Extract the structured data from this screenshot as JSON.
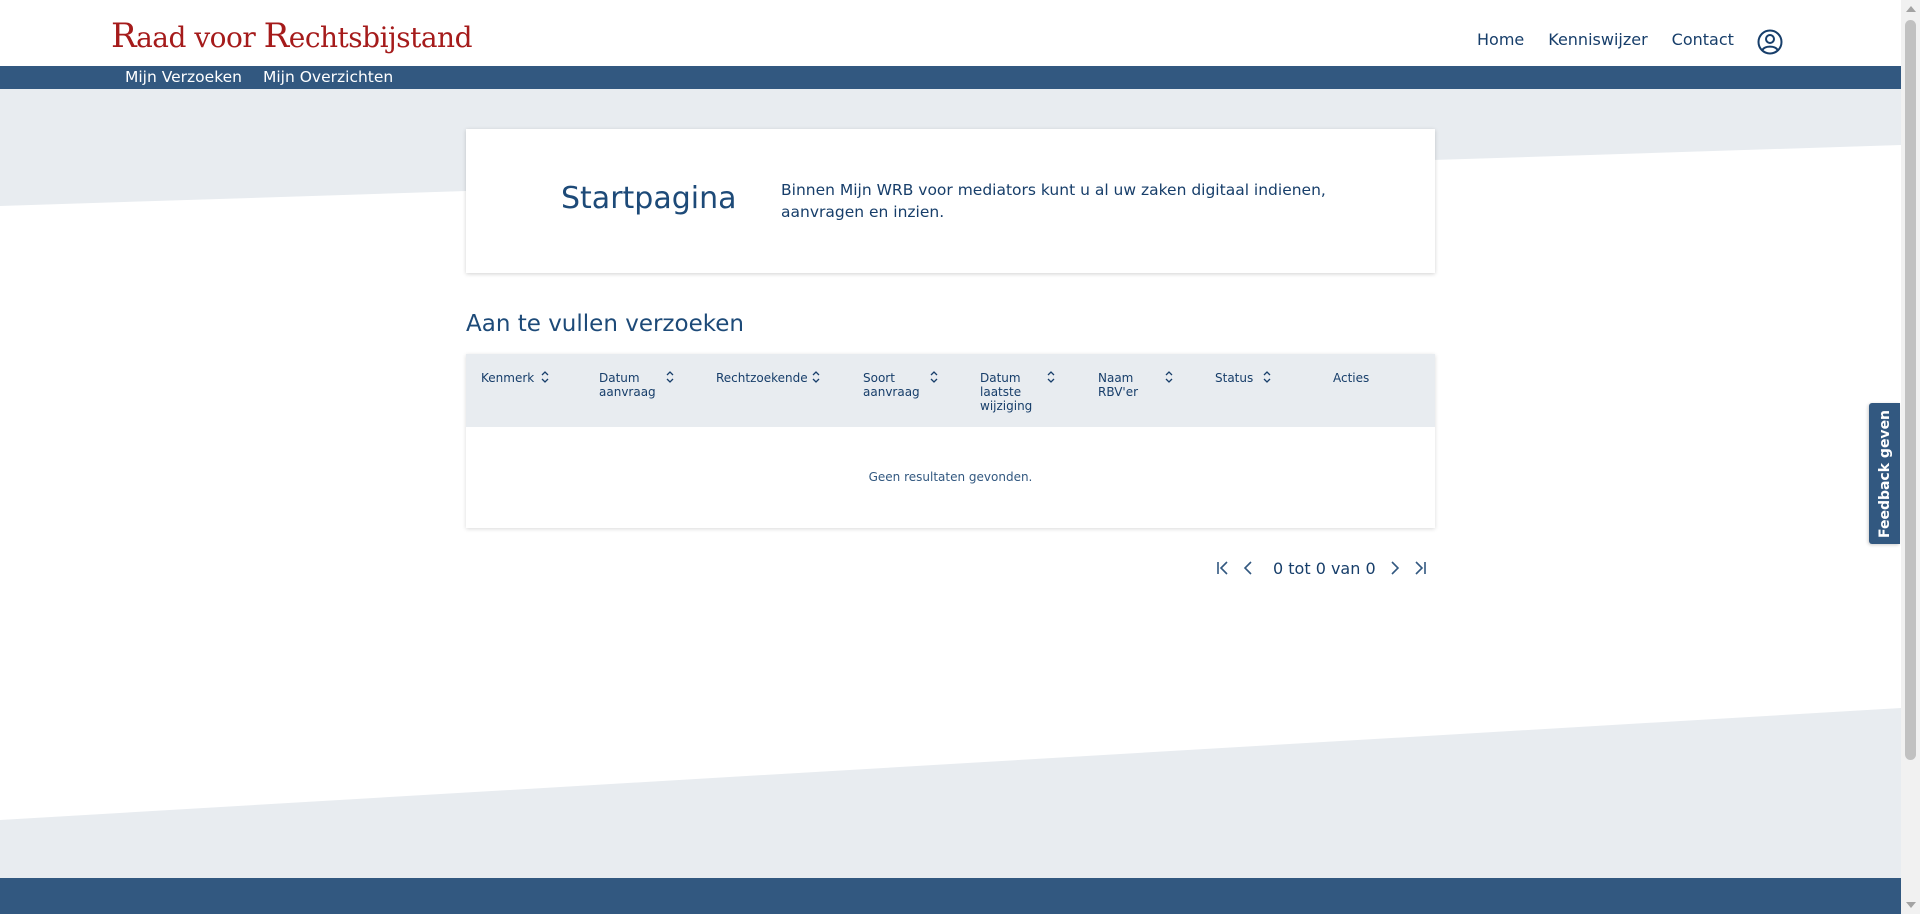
{
  "header": {
    "logo_first_cap": "R",
    "logo_first_rest": "aad voor ",
    "logo_second_cap": "R",
    "logo_second_rest": "echtsbijstand",
    "nav": [
      "Home",
      "Kenniswijzer",
      "Contact"
    ],
    "user_icon": "user-circle-icon"
  },
  "subnav": {
    "items": [
      "Mijn Verzoeken",
      "Mijn Overzichten"
    ]
  },
  "intro": {
    "title": "Startpagina",
    "text": "Binnen Mijn WRB voor mediators kunt u al uw zaken digitaal indienen, aanvragen en inzien."
  },
  "section": {
    "title": "Aan te vullen verzoeken"
  },
  "table": {
    "columns": [
      {
        "label": "Kenmerk",
        "sortable": true
      },
      {
        "label": "Datum aanvraag",
        "sortable": true
      },
      {
        "label": "Rechtzoekende",
        "sortable": true
      },
      {
        "label": "Soort aanvraag",
        "sortable": true
      },
      {
        "label": "Datum laatste wijziging",
        "sortable": true
      },
      {
        "label": "Naam RBV'er",
        "sortable": true
      },
      {
        "label": "Status",
        "sortable": true
      },
      {
        "label": "Acties",
        "sortable": false
      }
    ],
    "rows": [],
    "empty_message": "Geen resultaten gevonden."
  },
  "pagination": {
    "text": "0 tot 0 van 0"
  },
  "feedback": {
    "label": "Feedback geven"
  },
  "colors": {
    "brand_blue": "#325880",
    "logo_red": "#a51b1b",
    "text_blue": "#173e6a",
    "background_grey": "#e8ecf0"
  }
}
